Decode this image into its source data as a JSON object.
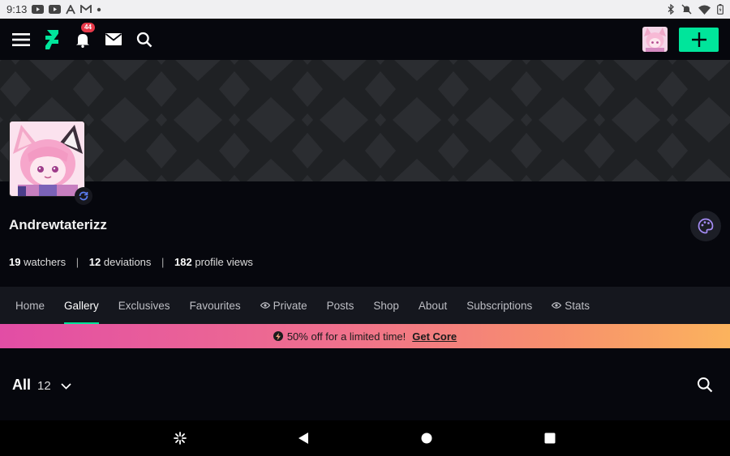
{
  "status_bar": {
    "time": "9:13",
    "left_icons": [
      "youtube-icon",
      "youtube-icon",
      "font-icon",
      "gmail-icon",
      "dot-icon"
    ],
    "right_icons": [
      "bluetooth-icon",
      "mute-icon",
      "wifi-icon",
      "battery-icon"
    ]
  },
  "app_bar": {
    "menu_icon": "menu-icon",
    "logo_icon": "deviantart-logo-icon",
    "notifications_badge": "44",
    "create_label": "+"
  },
  "profile": {
    "username": "Andrewtaterizz",
    "watchers_count": "19",
    "watchers_label": "watchers",
    "deviations_count": "12",
    "deviations_label": "deviations",
    "views_count": "182",
    "views_label": "profile views",
    "separator": "|"
  },
  "tabs": [
    {
      "label": "Home",
      "active": false,
      "private": false
    },
    {
      "label": "Gallery",
      "active": true,
      "private": false
    },
    {
      "label": "Exclusives",
      "active": false,
      "private": false
    },
    {
      "label": "Favourites",
      "active": false,
      "private": false
    },
    {
      "label": "Private",
      "active": false,
      "private": true
    },
    {
      "label": "Posts",
      "active": false,
      "private": false
    },
    {
      "label": "Shop",
      "active": false,
      "private": false
    },
    {
      "label": "About",
      "active": false,
      "private": false
    },
    {
      "label": "Subscriptions",
      "active": false,
      "private": false
    },
    {
      "label": "Stats",
      "active": false,
      "private": true
    }
  ],
  "promo": {
    "text": "50% off for a limited time!",
    "cta": "Get Core"
  },
  "gallery": {
    "title": "All",
    "count": "12"
  },
  "colors": {
    "accent": "#00e59b",
    "badge": "#e8394a",
    "background": "#06070d",
    "tabs_bg": "#15171e"
  }
}
